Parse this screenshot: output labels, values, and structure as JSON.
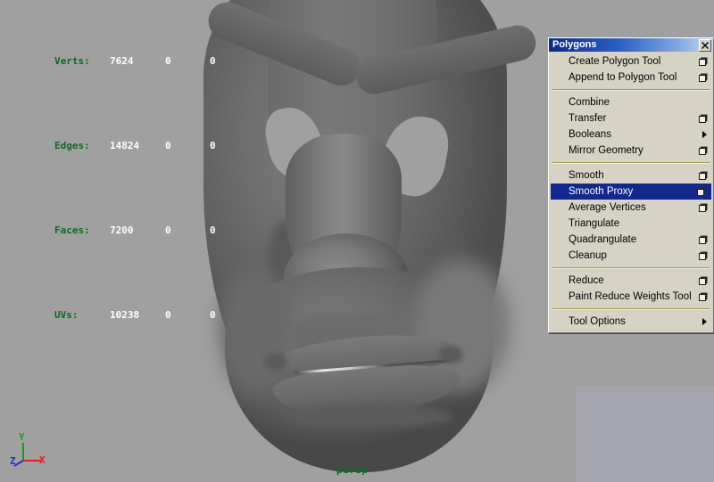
{
  "viewport": {
    "background_color": "#a0a0a0",
    "view_label": "persp",
    "view_label_color": "#0a6b25",
    "model_description": "shaded grey polygon head model, inverted",
    "axis_gizmo": {
      "name": "axis-gizmo",
      "axes": [
        {
          "label": "Y",
          "color": "#10a010"
        },
        {
          "label": "X",
          "color": "#e02020"
        },
        {
          "label": "Z",
          "color": "#2030e0"
        }
      ]
    }
  },
  "hud": {
    "label_color": "#0a6b25",
    "value_color": "#ffffff",
    "rows": [
      {
        "label": "Verts:",
        "total": "7624",
        "selected": "0",
        "extra": "0"
      },
      {
        "label": "Edges:",
        "total": "14824",
        "selected": "0",
        "extra": "0"
      },
      {
        "label": "Faces:",
        "total": "7200",
        "selected": "0",
        "extra": "0"
      },
      {
        "label": "UVs:",
        "total": "10238",
        "selected": "0",
        "extra": "0"
      }
    ]
  },
  "menu": {
    "title": "Polygons",
    "title_color": "#ffffff",
    "titlebar_gradient_start": "#0a2a8c",
    "titlebar_gradient_end": "#c6d9f2",
    "panel_background": "#d6d3c4",
    "separator_color": "#9a9a3c",
    "highlight_color": "#12288e",
    "close_icon": "close-icon",
    "groups": [
      {
        "items": [
          {
            "label": "Create Polygon Tool",
            "option_box": true,
            "submenu": false,
            "selected": false
          },
          {
            "label": "Append to Polygon Tool",
            "option_box": true,
            "submenu": false,
            "selected": false
          }
        ]
      },
      {
        "items": [
          {
            "label": "Combine",
            "option_box": false,
            "submenu": false,
            "selected": false
          },
          {
            "label": "Transfer",
            "option_box": true,
            "submenu": false,
            "selected": false
          },
          {
            "label": "Booleans",
            "option_box": false,
            "submenu": true,
            "selected": false
          },
          {
            "label": "Mirror Geometry",
            "option_box": true,
            "submenu": false,
            "selected": false
          }
        ]
      },
      {
        "items": [
          {
            "label": "Smooth",
            "option_box": true,
            "submenu": false,
            "selected": false
          },
          {
            "label": "Smooth Proxy",
            "option_box": true,
            "submenu": false,
            "selected": true
          },
          {
            "label": "Average Vertices",
            "option_box": true,
            "submenu": false,
            "selected": false
          },
          {
            "label": "Triangulate",
            "option_box": false,
            "submenu": false,
            "selected": false
          },
          {
            "label": "Quadrangulate",
            "option_box": true,
            "submenu": false,
            "selected": false
          },
          {
            "label": "Cleanup",
            "option_box": true,
            "submenu": false,
            "selected": false
          }
        ]
      },
      {
        "items": [
          {
            "label": "Reduce",
            "option_box": true,
            "submenu": false,
            "selected": false
          },
          {
            "label": "Paint Reduce Weights Tool",
            "option_box": true,
            "submenu": false,
            "selected": false
          }
        ]
      },
      {
        "items": [
          {
            "label": "Tool Options",
            "option_box": false,
            "submenu": true,
            "selected": false
          }
        ]
      }
    ]
  }
}
